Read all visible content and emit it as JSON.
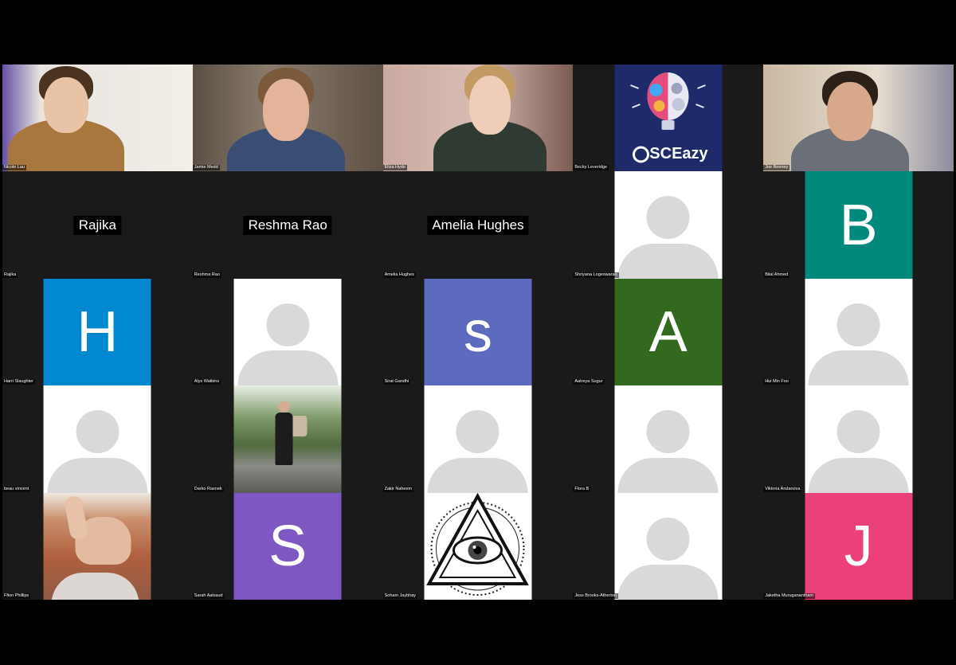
{
  "meeting": {
    "participants": [
      {
        "name": "Nicole Lau",
        "kind": "camera",
        "scene": "nicole"
      },
      {
        "name": "Jamie Medd",
        "kind": "camera",
        "scene": "jamie"
      },
      {
        "name": "Eliza Hyde",
        "kind": "camera",
        "scene": "eliza"
      },
      {
        "name": "Becky Leveridge",
        "kind": "logo",
        "logo_text": "SCEazy"
      },
      {
        "name": "Joe Beeney",
        "kind": "camera",
        "scene": "joe"
      },
      {
        "name": "Rajika",
        "kind": "name",
        "display": "Rajika"
      },
      {
        "name": "Reshma Rao",
        "kind": "name",
        "display": "Reshma Rao"
      },
      {
        "name": "Amelia Hughes",
        "kind": "name",
        "display": "Amelia Hughes"
      },
      {
        "name": "Shriyana Logeswaran",
        "kind": "avatar"
      },
      {
        "name": "Bilal Ahmed",
        "kind": "initial",
        "letter": "B",
        "color": "#00897b"
      },
      {
        "name": "Harri Slaughter",
        "kind": "initial",
        "letter": "H",
        "color": "#0288d1"
      },
      {
        "name": "Alys Watkins",
        "kind": "avatar"
      },
      {
        "name": "Sirat Gandhi",
        "kind": "initial",
        "letter": "s",
        "color": "#5c6bc0"
      },
      {
        "name": "Aatreya Sugur",
        "kind": "initial",
        "letter": "A",
        "color": "#33691e"
      },
      {
        "name": "Hui Min Foo",
        "kind": "avatar"
      },
      {
        "name": "beau vincent",
        "kind": "avatar"
      },
      {
        "name": "Darko Rasnek",
        "kind": "photo",
        "scene": "darko"
      },
      {
        "name": "Zakir Naheem",
        "kind": "avatar"
      },
      {
        "name": "Flora B",
        "kind": "avatar"
      },
      {
        "name": "Viktoria Andanova",
        "kind": "avatar"
      },
      {
        "name": "Ffion Phillips",
        "kind": "photo",
        "scene": "thumb"
      },
      {
        "name": "Sarah Aalsaud",
        "kind": "initial",
        "letter": "S",
        "color": "#7e57c2"
      },
      {
        "name": "Soham Jaybhay",
        "kind": "photo",
        "scene": "eye"
      },
      {
        "name": "Jess Brooks-Atherton",
        "kind": "avatar"
      },
      {
        "name": "Jaketha Muruganantham",
        "kind": "initial",
        "letter": "J",
        "color": "#ec407a"
      }
    ]
  }
}
